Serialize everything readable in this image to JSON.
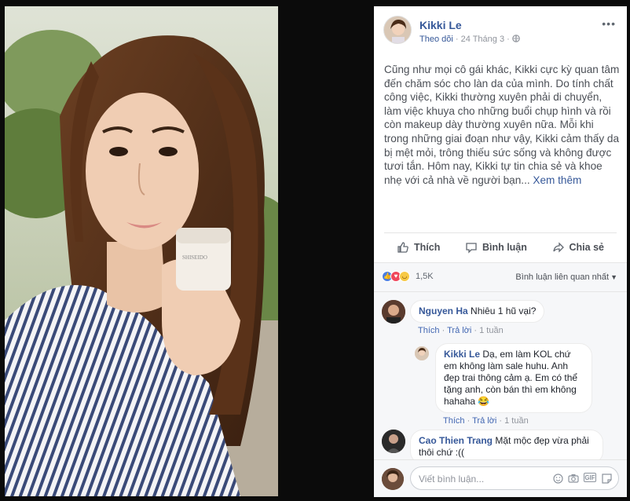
{
  "post": {
    "author": "Kikki Le",
    "follow": "Theo dõi",
    "date": "24 Tháng 3",
    "dot": "·",
    "globe_icon": "globe-icon",
    "more": "•••",
    "text": "Cũng như mọi cô gái khác, Kikki cực kỳ quan tâm đến chăm sóc cho làn da của mình. Do tính chất công việc, Kikki thường xuyên phải di chuyển, làm việc khuya cho những buổi chụp hình và rồi còn makeup dày thường xuyên nữa. Mỗi khi trong những giai đoạn như vậy, Kikki cảm thấy da bị mệt mỏi, trông thiếu sức sống và không được tươi tắn. Hôm nay, Kikki tự tin chia sẻ và khoe nhẹ với cả nhà về người bạn...",
    "see_more": "Xem thêm",
    "product_label": "SHISEIDO"
  },
  "actions": {
    "like": "Thích",
    "comment": "Bình luận",
    "share": "Chia sẻ"
  },
  "reactions": {
    "count": "1,5K",
    "sort_label": "Bình luận liên quan nhất"
  },
  "comments": [
    {
      "name": "Nguyen Ha",
      "text": "Nhiêu 1 hũ vại?",
      "like": "Thích",
      "reply": "Trả lời",
      "time": "1 tuần"
    },
    {
      "name": "Kikki Le",
      "text": "Dạ, em làm KOL chứ em không làm sale huhu. Anh đẹp trai thông cảm ạ. Em có thể tặng anh, còn bán thì em không hahaha",
      "emoji": "😂",
      "like": "Thích",
      "reply": "Trả lời",
      "time": "1 tuần"
    },
    {
      "name": "Cao Thien Trang",
      "text": "Mặt mộc đẹp vừa phải thôi chứ :(("
    }
  ],
  "composer": {
    "placeholder": "Viết bình luận..."
  },
  "colors": {
    "link": "#365899",
    "like_blue": "#4a7de2",
    "love": "#f0465b",
    "haha": "#f7c945"
  }
}
